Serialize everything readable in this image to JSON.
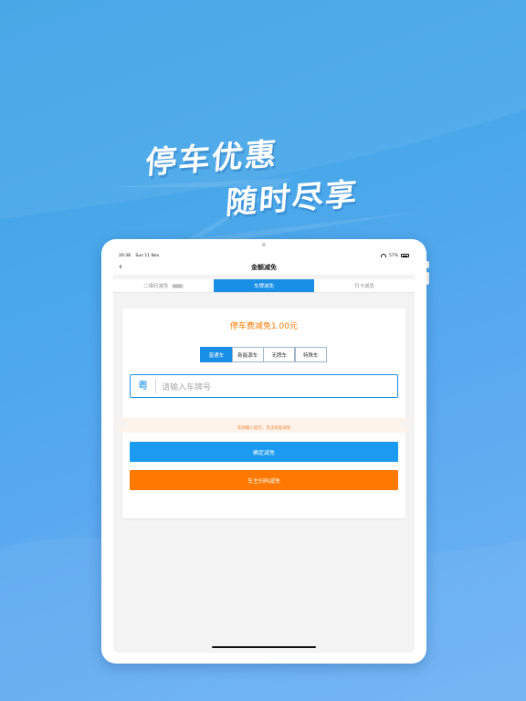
{
  "headline": {
    "line1": "停车优惠",
    "line2": "随时尽享"
  },
  "status": {
    "time": "20:38",
    "date": "Sun 11 Nov",
    "battery": "57%"
  },
  "nav": {
    "title": "金额减免",
    "back_icon": "chevron-left-icon"
  },
  "tabs": [
    {
      "label": "二维码减免",
      "badge": "NEW",
      "active": false
    },
    {
      "label": "车牌减免",
      "active": true
    },
    {
      "label": "扫卡减免",
      "active": false
    }
  ],
  "card": {
    "fee_title": "停车费减免1.00元",
    "vehicle_types": [
      "普通车",
      "新能源车",
      "无牌车",
      "特殊车"
    ],
    "selected_type": "普通车",
    "plate": {
      "province": "粤",
      "placeholder": "请输入车牌号",
      "value": ""
    },
    "hint": "车牌输入提示，无法恢复减免",
    "confirm_label": "确定减免",
    "scan_label": "车主扫码减免"
  },
  "colors": {
    "accent": "#1a8fe6",
    "orange": "#ff7800",
    "fee": "#ff7a00"
  }
}
